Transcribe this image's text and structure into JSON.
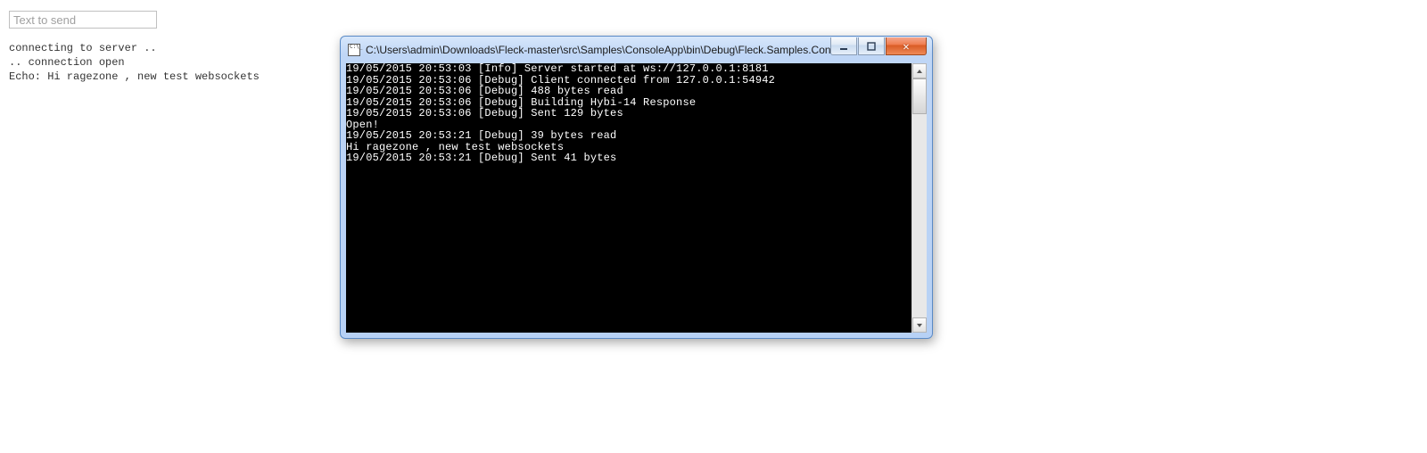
{
  "page": {
    "input_placeholder": "Text to send",
    "log_lines": [
      "connecting to server ..",
      ".. connection open",
      "Echo: Hi ragezone , new test websockets"
    ]
  },
  "window": {
    "title": "C:\\Users\\admin\\Downloads\\Fleck-master\\src\\Samples\\ConsoleApp\\bin\\Debug\\Fleck.Samples.Con...",
    "controls": {
      "minimize": "minimize",
      "maximize": "maximize",
      "close": "close"
    },
    "console_lines": [
      "19/05/2015 20:53:03 [Info] Server started at ws://127.0.0.1:8181",
      "19/05/2015 20:53:06 [Debug] Client connected from 127.0.0.1:54942",
      "19/05/2015 20:53:06 [Debug] 488 bytes read",
      "19/05/2015 20:53:06 [Debug] Building Hybi-14 Response",
      "19/05/2015 20:53:06 [Debug] Sent 129 bytes",
      "Open!",
      "19/05/2015 20:53:21 [Debug] 39 bytes read",
      "Hi ragezone , new test websockets",
      "19/05/2015 20:53:21 [Debug] Sent 41 bytes"
    ]
  }
}
